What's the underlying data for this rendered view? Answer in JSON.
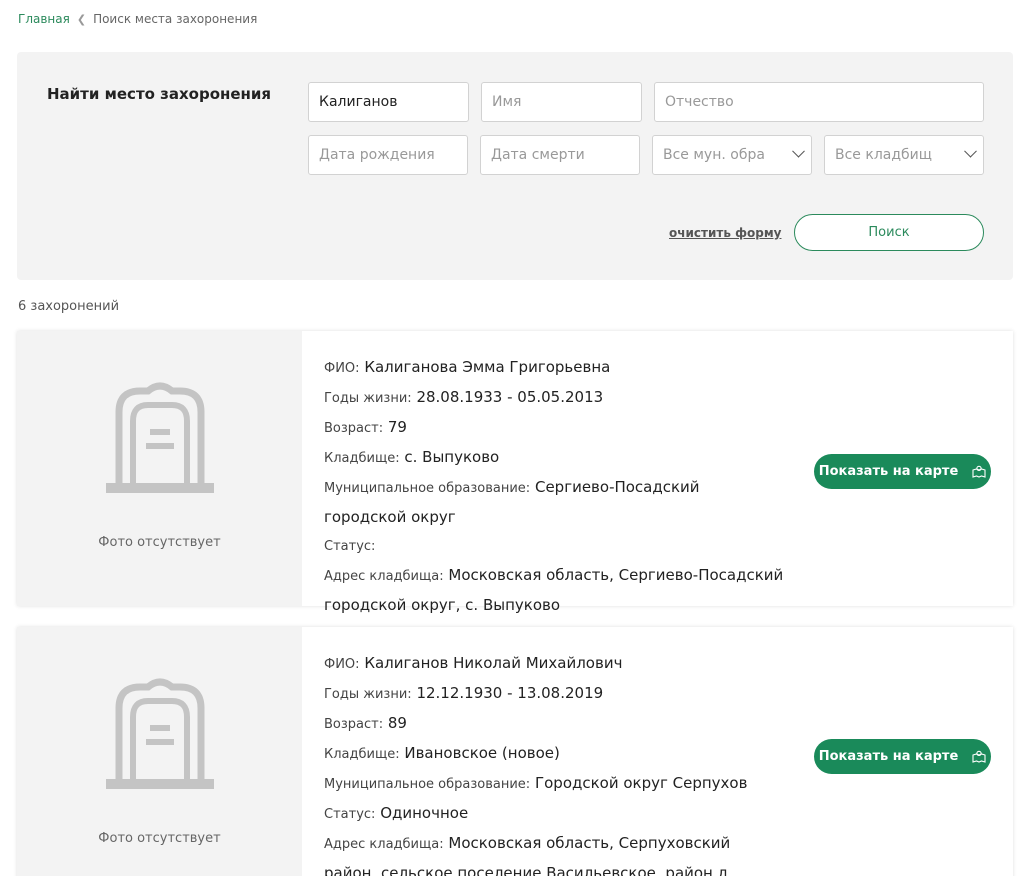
{
  "breadcrumb": {
    "home": "Главная",
    "current": "Поиск места захоронения"
  },
  "search": {
    "title": "Найти место захоронения",
    "surname_value": "Калиганов",
    "name_placeholder": "Имя",
    "patronymic_placeholder": "Отчество",
    "birth_placeholder": "Дата рождения",
    "death_placeholder": "Дата смерти",
    "municipality_value": "Все мун. обра",
    "cemetery_value": "Все кладбищ",
    "clear_label": "очистить форму",
    "search_label": "Поиск"
  },
  "results_count": "6 захоронений",
  "labels": {
    "fio": "ФИО:",
    "years": "Годы жизни:",
    "age": "Возраст:",
    "cemetery": "Кладбище:",
    "municipality": "Муниципальное образование:",
    "status": "Статус:",
    "address": "Адрес кладбища:",
    "no_photo": "Фото отсутствует",
    "show_on_map": "Показать на карте"
  },
  "results": [
    {
      "fio": "Калиганова Эмма Григорьевна",
      "years": "28.08.1933 - 05.05.2013",
      "age": "79",
      "cemetery": "с. Выпуково",
      "municipality": "Сергиево-Посадский городской округ",
      "status": "",
      "address": "Московская область, Сергиево-Посадский городской округ, с. Выпуково"
    },
    {
      "fio": "Калиганов Николай Михайлович",
      "years": "12.12.1930 - 13.08.2019",
      "age": "89",
      "cemetery": "Ивановское (новое)",
      "municipality": "Городской округ Серпухов",
      "status": "Одиночное",
      "address": "Московская область, Серпуховский район, сельское поселение Васильевское, район д. Ивановское"
    }
  ],
  "colors": {
    "accent": "#1a8a5a",
    "link": "#2b8a5c",
    "panel": "#f3f3f3"
  }
}
